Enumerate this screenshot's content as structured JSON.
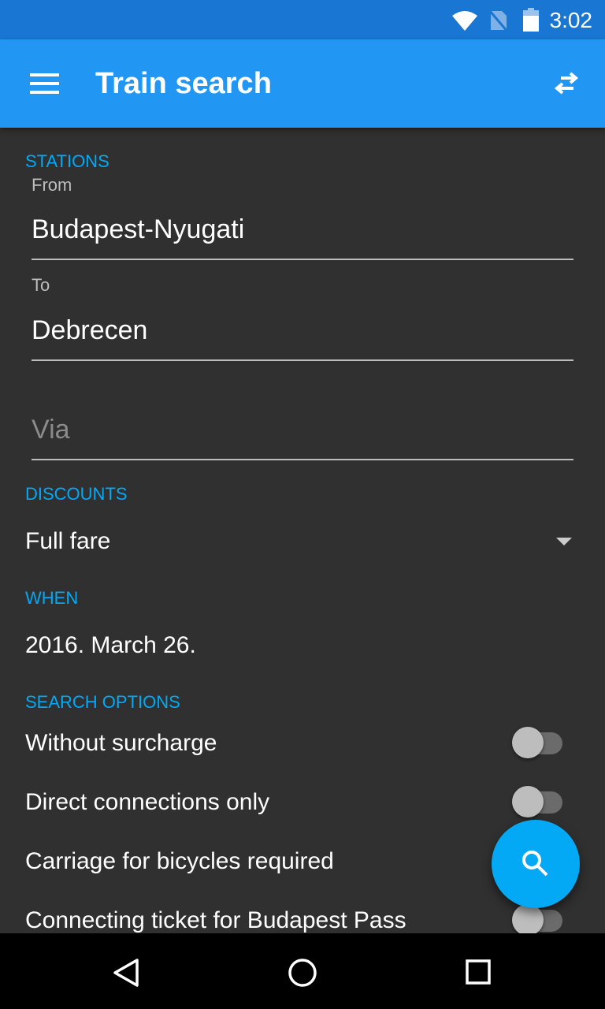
{
  "status_bar": {
    "time": "3:02",
    "icons": [
      "wifi-icon",
      "no-sim-icon",
      "battery-icon"
    ]
  },
  "app_bar": {
    "title": "Train search",
    "menu_icon": "menu-icon",
    "action_icon": "swap-icon"
  },
  "stations": {
    "section": "STATIONS",
    "from_label": "From",
    "from_value": "Budapest-Nyugati",
    "to_label": "To",
    "to_value": "Debrecen",
    "via_placeholder": "Via"
  },
  "discounts": {
    "section": "DISCOUNTS",
    "selected": "Full fare"
  },
  "when": {
    "section": "WHEN",
    "date": "2016. March 26."
  },
  "search_options": {
    "section": "SEARCH OPTIONS",
    "items": [
      {
        "label": "Without surcharge",
        "on": false
      },
      {
        "label": "Direct connections only",
        "on": false
      },
      {
        "label": "Carriage for bicycles required",
        "on": false
      },
      {
        "label": "Connecting ticket for Budapest Pass",
        "on": false
      }
    ]
  },
  "colors": {
    "accent": "#03A9F4",
    "primary": "#2196F3",
    "status": "#1976D2",
    "background": "#303030"
  }
}
